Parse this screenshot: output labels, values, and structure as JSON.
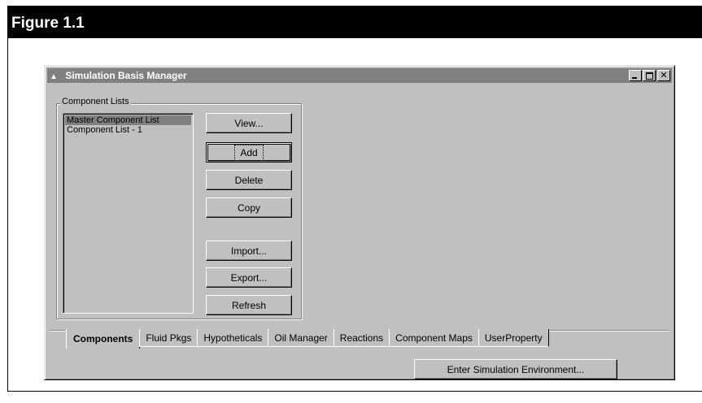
{
  "figure": {
    "title": "Figure 1.1"
  },
  "window": {
    "title": "Simulation Basis Manager",
    "icon": "app-icon"
  },
  "group": {
    "label": "Component Lists",
    "items": [
      "Master Component List",
      "Component List - 1"
    ],
    "selected_index": 0
  },
  "buttons": {
    "view": "View...",
    "add": "Add",
    "delete": "Delete",
    "copy": "Copy",
    "import": "Import...",
    "export": "Export...",
    "refresh": "Refresh"
  },
  "tabs": [
    "Components",
    "Fluid Pkgs",
    "Hypotheticals",
    "Oil Manager",
    "Reactions",
    "Component Maps",
    "UserProperty"
  ],
  "active_tab": "Components",
  "env_button": "Enter Simulation Environment...",
  "colors": {
    "face": "#c0c0c0",
    "titlebar": "#808080",
    "banner": "#000000"
  }
}
